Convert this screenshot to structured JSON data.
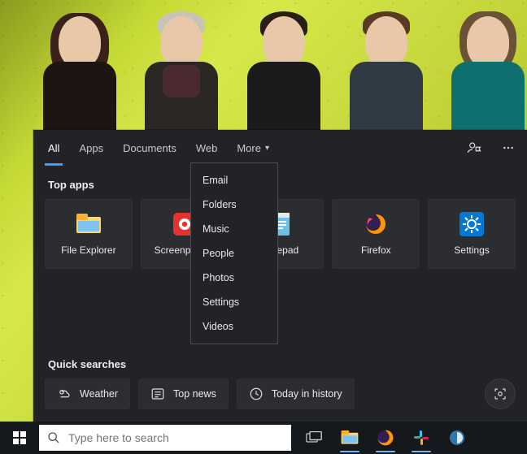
{
  "tabs": {
    "all": "All",
    "apps": "Apps",
    "documents": "Documents",
    "web": "Web",
    "more": "More"
  },
  "sections": {
    "top_apps": "Top apps",
    "quick_searches": "Quick searches"
  },
  "top_apps": [
    {
      "label": "File Explorer"
    },
    {
      "label": "Screenpresso"
    },
    {
      "label": "Notepad"
    },
    {
      "label": "Firefox"
    },
    {
      "label": "Settings"
    }
  ],
  "more_menu": [
    "Email",
    "Folders",
    "Music",
    "People",
    "Photos",
    "Settings",
    "Videos"
  ],
  "quick": {
    "weather": "Weather",
    "top_news": "Top news",
    "today": "Today in history"
  },
  "search": {
    "placeholder": "Type here to search"
  }
}
